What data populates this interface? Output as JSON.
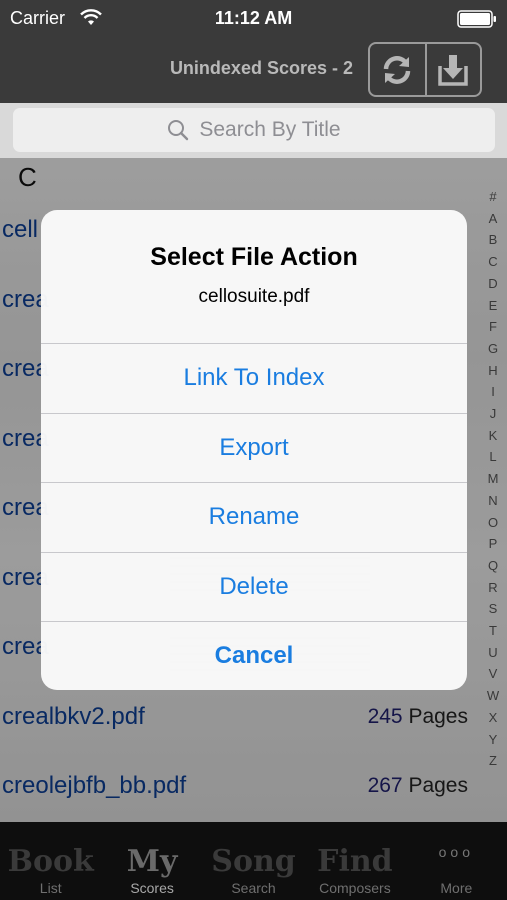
{
  "status_bar": {
    "carrier": "Carrier",
    "time": "11:12 AM"
  },
  "nav": {
    "title": "Unindexed Scores - 2",
    "refresh_icon": "refresh-icon",
    "download_icon": "download-icon"
  },
  "search": {
    "placeholder": "Search By Title",
    "icon": "search-icon"
  },
  "list": {
    "section_header": "C",
    "rows": [
      {
        "name": "cell",
        "pages": "",
        "pages_suffix": ""
      },
      {
        "name": "crea",
        "pages": "",
        "pages_suffix": ""
      },
      {
        "name": "crea",
        "pages": "",
        "pages_suffix": ""
      },
      {
        "name": "crea",
        "pages": "",
        "pages_suffix": ""
      },
      {
        "name": "crea",
        "pages": "",
        "pages_suffix": ""
      },
      {
        "name": "crea",
        "pages": "",
        "pages_suffix": ""
      },
      {
        "name": "crea",
        "pages": "",
        "pages_suffix": ""
      },
      {
        "name": "crealbkv2.pdf",
        "pages": "245",
        "pages_suffix": " Pages"
      },
      {
        "name": "creolejbfb_bb.pdf",
        "pages": "267",
        "pages_suffix": " Pages"
      }
    ],
    "index_letters": [
      "#",
      "A",
      "B",
      "C",
      "D",
      "E",
      "F",
      "G",
      "H",
      "I",
      "J",
      "K",
      "L",
      "M",
      "N",
      "O",
      "P",
      "Q",
      "R",
      "S",
      "T",
      "U",
      "V",
      "W",
      "X",
      "Y",
      "Z"
    ]
  },
  "alert": {
    "title": "Select File Action",
    "message": "cellosuite.pdf",
    "actions": [
      "Link To Index",
      "Export",
      "Rename",
      "Delete"
    ],
    "cancel": "Cancel",
    "action_color": "#1a7de0"
  },
  "tabs": [
    {
      "icon_text": "Book",
      "label": "List",
      "active": false
    },
    {
      "icon_text": "My",
      "label": "Scores",
      "active": true
    },
    {
      "icon_text": "Song",
      "label": "Search",
      "active": false
    },
    {
      "icon_text": "Find",
      "label": "Composers",
      "active": false
    },
    {
      "icon_text": "ooo",
      "label": "More",
      "active": false
    }
  ]
}
